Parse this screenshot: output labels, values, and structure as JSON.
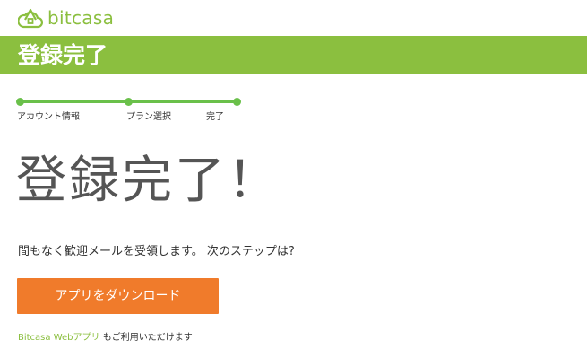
{
  "header": {
    "brand_name": "bitcasa",
    "logo_icon": "cloud-house-icon",
    "brand_color": "#8bbf3f"
  },
  "banner": {
    "title": "登録完了",
    "background": "#8bbf3f"
  },
  "stepper": {
    "color": "#6ac04a",
    "steps": [
      {
        "label": "アカウント情報"
      },
      {
        "label": "プラン選択"
      },
      {
        "label": "完了"
      }
    ]
  },
  "main": {
    "headline": "登録完了！",
    "message": "間もなく歓迎メールを受領します。 次のステップは?",
    "download_button_label": "アプリをダウンロード",
    "download_button_color": "#f07b2b"
  },
  "footer": {
    "link_text": "Bitcasa Webアプリ",
    "text": " もご利用いただけます"
  }
}
